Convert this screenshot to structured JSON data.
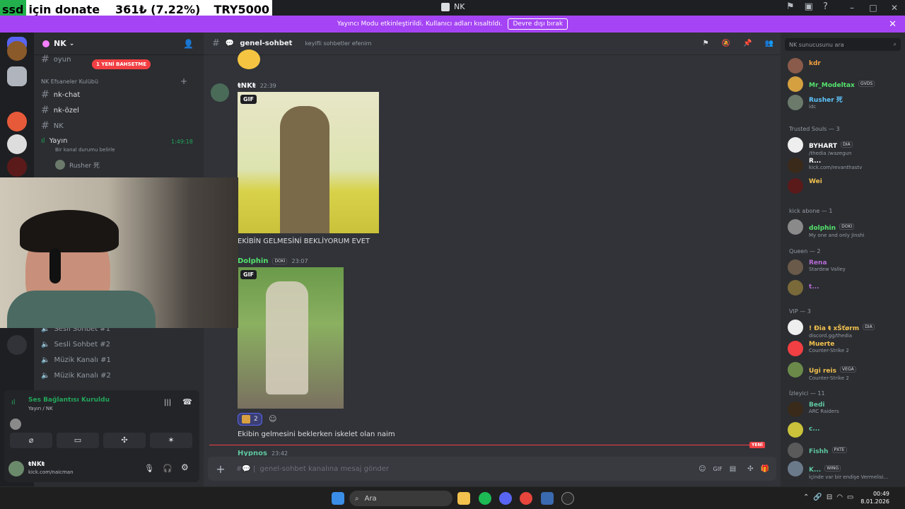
{
  "window": {
    "title": "NK"
  },
  "donate": {
    "prefix": "ssd",
    "label": "için donate",
    "amount": "361₺ (7.22%)",
    "goal": "TRY5000"
  },
  "banner": {
    "text": "Yayıncı Modu etkinleştirildi. Kullanıcı adları kısaltıldı.",
    "button": "Devre dışı bırak"
  },
  "server": {
    "name": "NK",
    "channel_partial": "oyun",
    "mention_pill": "1 YENİ BAHSETME",
    "category": "NK Efsaneler Kulübü",
    "text_channels": [
      "nk-chat",
      "nk-özel",
      "NK"
    ],
    "voice": {
      "name": "Yayın",
      "status": "Bir kanal durumu belirle",
      "timer": "1:49:18",
      "member": "Rusher 死"
    },
    "voice_channels": [
      "Sesli Sohbet #1",
      "Sesli Sohbet #2",
      "Müzik Kanalı #1",
      "Müzik Kanalı #2"
    ]
  },
  "voice_panel": {
    "status": "Ses Bağlantısı Kuruldu",
    "location": "Yayın / NK"
  },
  "user": {
    "name": "ŧNKŧ",
    "status": "kick.com/naicman"
  },
  "chat": {
    "channel": "genel-sohbet",
    "topic": "keyifli sohbetler efenim",
    "messages": [
      {
        "author": "ŧNKŧ",
        "time": "22:39",
        "gif_label": "GIF",
        "text": "EKİBİN GELMESİNİ BEKLİYORUM EVET"
      },
      {
        "author": "Dolphin",
        "badge": "DOKI",
        "time": "23:07",
        "gif_label": "GIF",
        "reaction_count": "2",
        "text": "Ekibin gelmesini beklerken iskelet olan naim"
      },
      {
        "author": "Hypnos",
        "time": "23:42"
      }
    ],
    "new_label": "YENİ",
    "composer_placeholder": "genel-sohbet kanalına mesaj gönder"
  },
  "members": {
    "search_placeholder": "NK sunucusunu ara",
    "top": [
      {
        "name": "kdr",
        "color": "#f2a140"
      },
      {
        "name": "Mr_Modeltax",
        "tag": "GVDS",
        "color": "#55e36d"
      },
      {
        "name": "Rusher 死",
        "sub": "idc",
        "color": "#5fc7ff"
      }
    ],
    "sections": [
      {
        "title": "Trusted Souls — 3",
        "items": [
          {
            "name": "BYHART",
            "tag": "DIA",
            "sub": "/thedia /wazegun",
            "color": "#fff"
          },
          {
            "name": "R...",
            "sub": "kick.com/revanthastv",
            "color": "#fff"
          },
          {
            "name": "Wei",
            "color": "#f2c14e"
          }
        ]
      },
      {
        "title": "kick abone — 1",
        "items": [
          {
            "name": "dolphin",
            "tag": "DOKI",
            "sub": "My one and only Jinshi",
            "color": "#55e36d"
          }
        ]
      },
      {
        "title": "Queen — 2",
        "items": [
          {
            "name": "Rena",
            "sub": "Stardew Valley",
            "color": "#b66ad6"
          },
          {
            "name": "t...",
            "color": "#b66ad6"
          }
        ]
      },
      {
        "title": "VIP — 3",
        "items": [
          {
            "name": "! Đia ŧ xŠťørm",
            "tag": "DIA",
            "sub": "discord.gg/thedia",
            "color": "#f2c14e"
          },
          {
            "name": "Muerte",
            "sub": "Counter-Strike 2",
            "color": "#f2c14e"
          },
          {
            "name": "Ugi reis",
            "tag": "VEGA",
            "sub": "Counter-Strike 2",
            "color": "#f2c14e"
          }
        ]
      },
      {
        "title": "İzleyici — 11",
        "items": [
          {
            "name": "Bedi",
            "sub": "ARC Raiders",
            "color": "#5fc7a0"
          },
          {
            "name": "c...",
            "color": "#5fc7a0"
          },
          {
            "name": "Fishh",
            "tag": "PXTE",
            "color": "#5fc7a0"
          },
          {
            "name": "K...",
            "tag": "WING",
            "sub": "İçinde var bir endişe Vermelisi...",
            "color": "#5fc7a0"
          }
        ]
      }
    ]
  },
  "taskbar": {
    "search": "Ara",
    "time": "00:49",
    "date": "8.01.2026"
  },
  "colors": {
    "blurple": "#5865f2",
    "banner": "#a544f4",
    "green": "#23a55a",
    "red": "#f23f43"
  }
}
